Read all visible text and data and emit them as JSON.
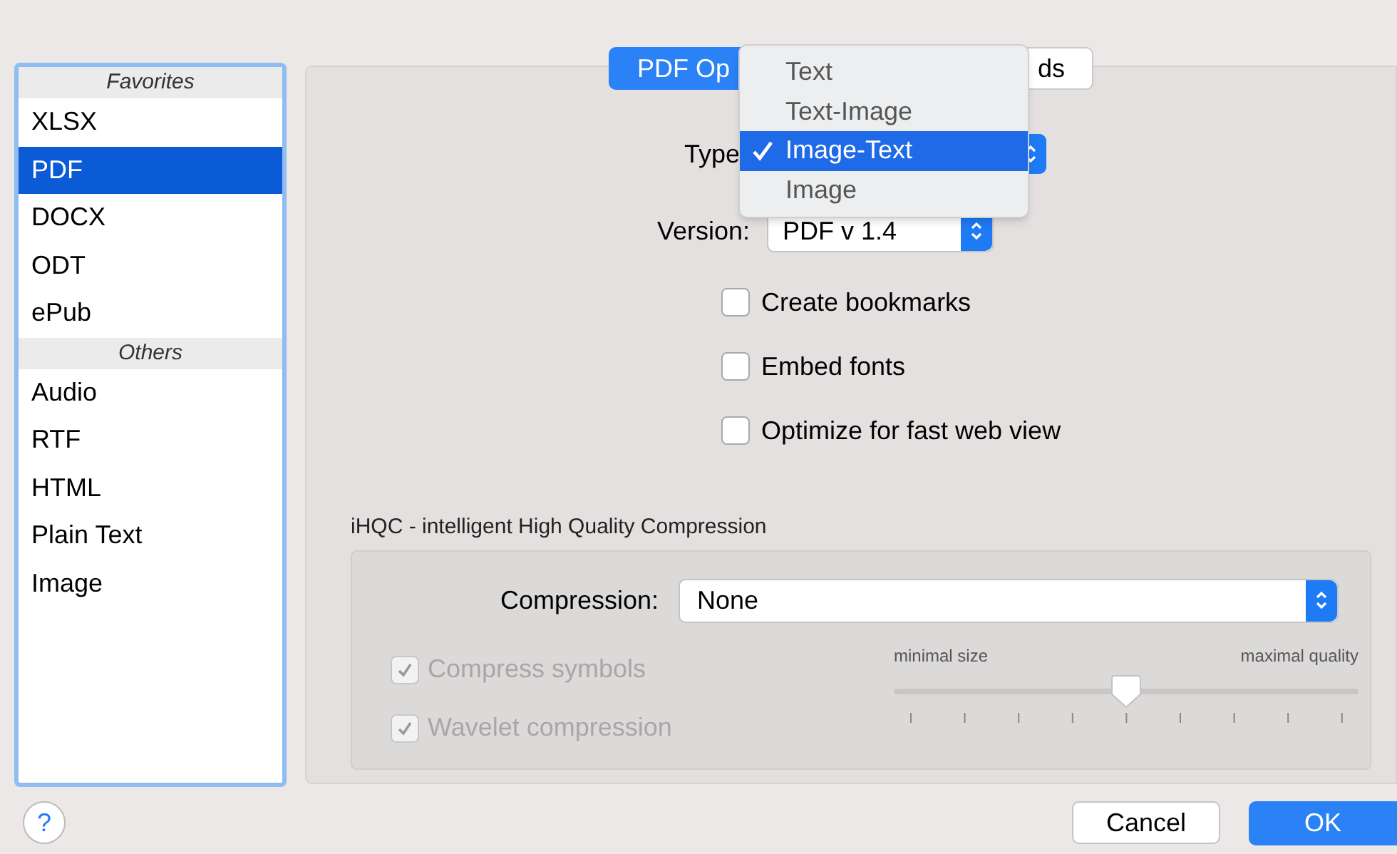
{
  "sidebar": {
    "sections": [
      {
        "header": "Favorites",
        "items": [
          {
            "label": "XLSX",
            "selected": false
          },
          {
            "label": "PDF",
            "selected": true
          },
          {
            "label": "DOCX",
            "selected": false
          },
          {
            "label": "ODT",
            "selected": false
          },
          {
            "label": "ePub",
            "selected": false
          }
        ]
      },
      {
        "header": "Others",
        "items": [
          {
            "label": "Audio",
            "selected": false
          },
          {
            "label": "RTF",
            "selected": false
          },
          {
            "label": "HTML",
            "selected": false
          },
          {
            "label": "Plain Text",
            "selected": false
          },
          {
            "label": "Image",
            "selected": false
          }
        ]
      }
    ]
  },
  "tabs": [
    {
      "label": "PDF Op",
      "selected": true
    },
    {
      "label": "ds",
      "selected": false
    }
  ],
  "type_field": {
    "label": "Type",
    "menu": [
      {
        "label": "Text",
        "selected": false
      },
      {
        "label": "Text-Image",
        "selected": false
      },
      {
        "label": "Image-Text",
        "selected": true
      },
      {
        "label": "Image",
        "selected": false
      }
    ]
  },
  "version_field": {
    "label": "Version:",
    "value": "PDF v 1.4"
  },
  "options": [
    {
      "label": "Create bookmarks",
      "checked": false
    },
    {
      "label": "Embed fonts",
      "checked": false
    },
    {
      "label": "Optimize for fast web view",
      "checked": false
    }
  ],
  "compression_group": {
    "title": "iHQC - intelligent High Quality Compression",
    "compression": {
      "label": "Compression:",
      "value": "None"
    },
    "options": [
      {
        "label": "Compress symbols",
        "checked": true,
        "disabled": true
      },
      {
        "label": "Wavelet compression",
        "checked": true,
        "disabled": true
      }
    ],
    "slider": {
      "min_label": "minimal size",
      "max_label": "maximal quality",
      "level": 0.5
    }
  },
  "buttons": [
    {
      "kind": "help",
      "label": "?"
    },
    {
      "kind": "cancel",
      "label": "Cancel"
    },
    {
      "kind": "ok",
      "label": "OK"
    }
  ]
}
